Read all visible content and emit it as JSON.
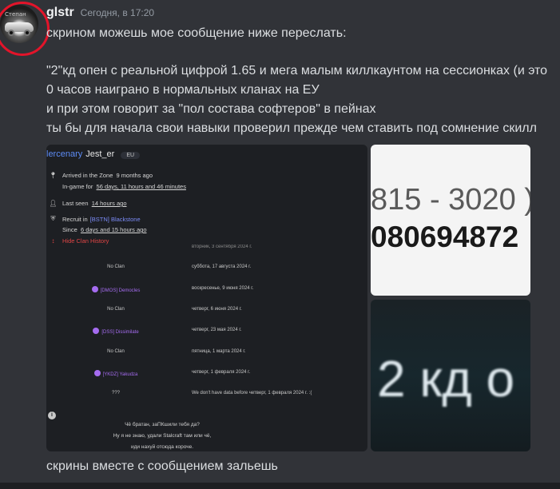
{
  "avatar": {
    "caption": "Степан"
  },
  "message": {
    "username": "glstr",
    "timestamp": "Сегодня, в 17:20",
    "lines": [
      "скрином можешь мое сообщение ниже переслать:",
      "\"2\"кд опен с реальной цифрой 1.65 и мега малым киллкаунтом на сессионках (и это",
      "0 часов наиграно в нормальных кланах на ЕУ",
      "и при этом говорит за \"пол состава софтеров\" в пейнах",
      "ты бы для начала свои навыки проверил прежде чем ставить под сомнение скилл"
    ],
    "footer": "скрины вместе с сообщением зальешь"
  },
  "profile": {
    "title_prefix": "lercenary",
    "name": "Jest_er",
    "region": "EU",
    "arrived": "Arrived in the Zone",
    "arrived_value": "9 months ago",
    "ingame_label": "In-game for",
    "ingame_value": "56 days, 11 hours and 46 minutes",
    "last_seen_label": "Last seen",
    "last_seen_value": "14 hours ago",
    "recruit_label": "Recruit in",
    "recruit_clan": "[BSTN] Blackstone",
    "since_label": "Since",
    "since_value": "6 days and 15 hours ago",
    "hide_history": "Hide Clan History",
    "history_cut": "вторник, 3 сентября 2024 г.",
    "history": [
      {
        "clan": "No Clan",
        "date": "суббота, 17 августа 2024 г.",
        "colored": false
      },
      {
        "clan": "[DMOS] Democles",
        "date": "воскресенье, 9 июня 2024 г.",
        "colored": true
      },
      {
        "clan": "No Clan",
        "date": "четверг, 6 июня 2024 г.",
        "colored": false
      },
      {
        "clan": "[DSS] Dissimilate",
        "date": "четверг, 23 мая 2024 г.",
        "colored": true
      },
      {
        "clan": "No Clan",
        "date": "пятница, 1 марта 2024 г.",
        "colored": false
      },
      {
        "clan": "[YKDZ] Yakudza",
        "date": "четверг, 1 февраля 2024 г.",
        "colored": true
      },
      {
        "clan": "???",
        "date": "We don't have data before четверг, 1 февраля 2024 г. :(",
        "colored": false
      }
    ],
    "bio": [
      "Чё братан, заПКшили тебя да?",
      "Ну я не знаю, удали Stalcraft там или чё,",
      "иди нахуй отсюда короче."
    ]
  },
  "image2": {
    "line1": "815 - 3020 ) -",
    "line2": "080694872"
  },
  "image3": {
    "text": "2 кд о"
  }
}
